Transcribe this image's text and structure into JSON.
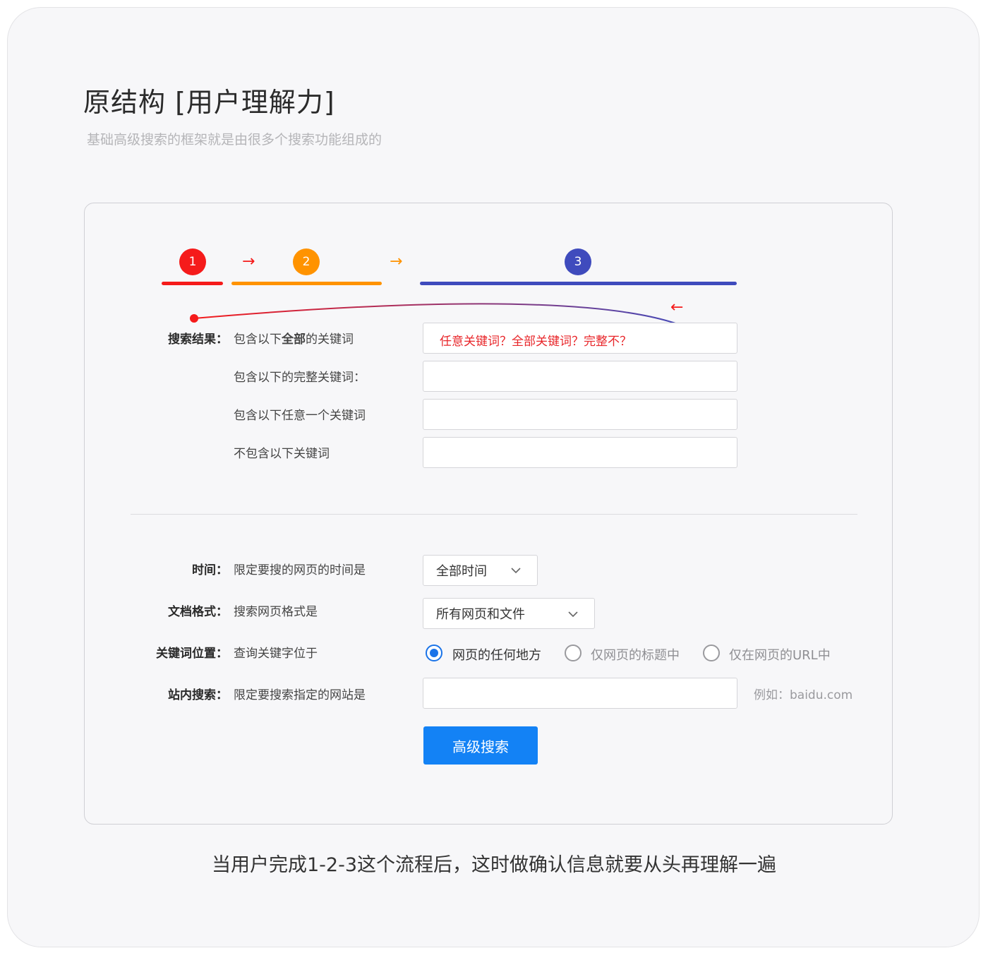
{
  "header": {
    "title": "原结构 [用户理解力]",
    "subtitle": "基础高级搜索的框架就是由很多个搜索功能组成的"
  },
  "steps": [
    {
      "number": "1",
      "color": "#f51b1b"
    },
    {
      "number": "2",
      "color": "#ff9300"
    },
    {
      "number": "3",
      "color": "#3f4bbd"
    }
  ],
  "annotation": {
    "hint": "任意关键词？全部关键词？完整不？",
    "arrow_color": "#f51b1b",
    "back_dot_color": "#3f4bbd"
  },
  "search_results": {
    "section_label": "搜索结果：",
    "rows": [
      {
        "label_prefix": "包含以下",
        "label_bold": "全部",
        "label_suffix": "的关键词"
      },
      {
        "label": "包含以下的完整关键词："
      },
      {
        "label": "包含以下任意一个关键词"
      },
      {
        "label": "不包含以下关键词"
      }
    ]
  },
  "time": {
    "section_label": "时间：",
    "description": "限定要搜的网页的时间是",
    "selected": "全部时间"
  },
  "format": {
    "section_label": "文档格式：",
    "description": "搜索网页格式是",
    "selected": "所有网页和文件"
  },
  "position": {
    "section_label": "关键词位置：",
    "description": "查询关键字位于",
    "options": [
      {
        "label": "网页的任何地方",
        "selected": true
      },
      {
        "label": "仅网页的标题中",
        "selected": false
      },
      {
        "label": "仅在网页的URL中",
        "selected": false
      }
    ]
  },
  "site": {
    "section_label": "站内搜索：",
    "description": "限定要搜索指定的网站是",
    "hint": "例如：baidu.com"
  },
  "submit_label": "高级搜索",
  "caption": "当用户完成1-2-3这个流程后，这时做确认信息就要从头再理解一遍",
  "colors": {
    "primary": "#1382f5",
    "radio_active": "#1a73e8"
  }
}
